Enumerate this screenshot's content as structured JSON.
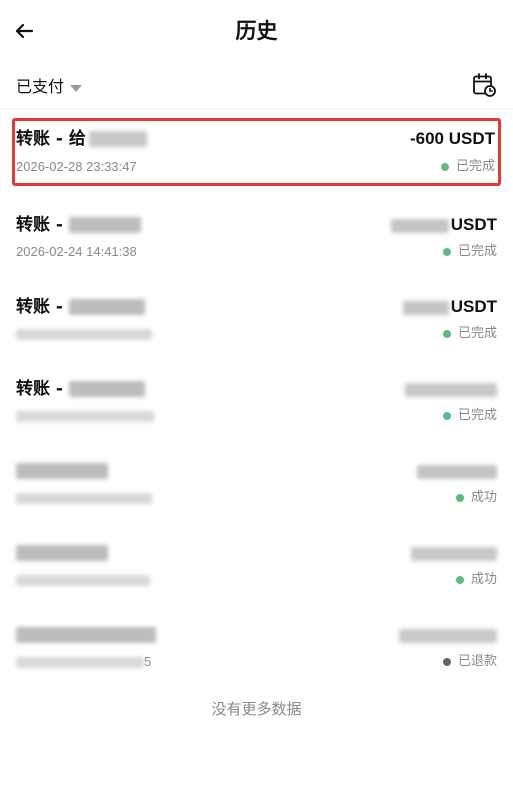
{
  "header": {
    "title": "历史",
    "back_icon": "arrow-left-icon"
  },
  "filter": {
    "selected": "已支付",
    "calendar_icon": "calendar-clock-icon"
  },
  "transactions": [
    {
      "title": "转账 - 给",
      "time": "2026-02-28 23:33:47",
      "amount": "-600 USDT",
      "status": "已完成",
      "status_color": "#5dbb81"
    },
    {
      "title": "转账 - ",
      "time": "2026-02-24 14:41:38",
      "amount": "USDT",
      "status": "已完成",
      "status_color": "#5dbb81"
    },
    {
      "title": "转账 - ",
      "time": "",
      "amount": "USDT",
      "status": "已完成",
      "status_color": "#5dbb81"
    },
    {
      "title": "转账 - ",
      "time": "",
      "amount": "",
      "status": "已完成",
      "status_color": "#5dbb81"
    },
    {
      "title": "",
      "time": "",
      "amount": "",
      "status": "成功",
      "status_color": "#5dbb81"
    },
    {
      "title": "",
      "time": "",
      "amount": "",
      "status": "成功",
      "status_color": "#5dbb81"
    },
    {
      "title": "",
      "time": "5",
      "amount": "",
      "status": "已退款",
      "status_color": "#666666"
    }
  ],
  "footer": {
    "no_more": "没有更多数据"
  }
}
